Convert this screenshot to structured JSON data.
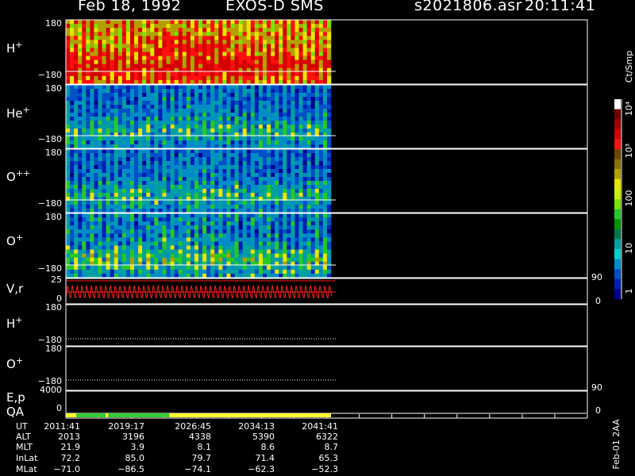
{
  "header": {
    "date": "Feb 18, 1992",
    "instrument": "EXOS-D SMS",
    "file": "s2021806.asr",
    "time": "20:11:41"
  },
  "colorbar": {
    "unit": "Ct/Smp",
    "tick_labels": [
      "10⁴",
      "10³",
      "100",
      "10",
      "1"
    ],
    "colors": [
      "#ffffff",
      "#6e0000",
      "#a00000",
      "#d40000",
      "#ff1010",
      "#6e4600",
      "#8c7000",
      "#b4a000",
      "#e6e600",
      "#c8f000",
      "#78e600",
      "#28c828",
      "#009600",
      "#007846",
      "#00a0a0",
      "#00d2d2",
      "#008cc8",
      "#0050c8",
      "#0020b4",
      "#00008c"
    ]
  },
  "footer": {
    "row_labels": [
      "UT",
      "ALT",
      "MLT",
      "InLat",
      "MLat"
    ],
    "columns": [
      {
        "UT": "2011:41",
        "ALT": "2013",
        "MLT": "21.9",
        "InLat": "72.2",
        "MLat": "−71.0"
      },
      {
        "UT": "2019:17",
        "ALT": "3196",
        "MLT": "3.9",
        "InLat": "85.0",
        "MLat": "−86.5"
      },
      {
        "UT": "2026:45",
        "ALT": "4338",
        "MLT": "8.1",
        "InLat": "79.7",
        "MLat": "−74.1"
      },
      {
        "UT": "2034:13",
        "ALT": "5390",
        "MLT": "8.6",
        "InLat": "71.4",
        "MLat": "−62.3"
      },
      {
        "UT": "2041:41",
        "ALT": "6322",
        "MLT": "8.7",
        "InLat": "65.3",
        "MLat": "−52.3"
      }
    ],
    "stamp": "Feb-01 2AA"
  },
  "chart_data": [
    {
      "type": "heatmap",
      "species": "H⁺",
      "ylabel": "H+",
      "yticks": [
        "180",
        "−180"
      ],
      "ylim": [
        -180,
        180
      ],
      "colorscale": "log counts per sample"
    },
    {
      "type": "heatmap",
      "species": "He⁺",
      "ylabel": "He+",
      "yticks": [
        "180",
        "−180"
      ],
      "ylim": [
        -180,
        180
      ]
    },
    {
      "type": "heatmap",
      "species": "O⁺⁺",
      "ylabel": "O++",
      "yticks": [
        "180",
        "−180"
      ],
      "ylim": [
        -180,
        180
      ]
    },
    {
      "type": "heatmap",
      "species": "O⁺",
      "ylabel": "O+",
      "yticks": [
        "180",
        "−180"
      ],
      "ylim": [
        -180,
        180
      ]
    },
    {
      "type": "line",
      "ylabel": "V,r",
      "left_ticks": [
        "25",
        "0"
      ],
      "right_ticks": [
        "90",
        "0"
      ],
      "ylim": [
        0,
        25
      ]
    },
    {
      "type": "line",
      "ylabel": "H+",
      "yticks": [
        "180",
        "−180"
      ],
      "ylim": [
        -180,
        180
      ]
    },
    {
      "type": "line",
      "ylabel": "O+",
      "yticks": [
        "180",
        "−180"
      ],
      "ylim": [
        -180,
        180
      ]
    },
    {
      "type": "line",
      "ylabel": "E,p",
      "left_ticks": [
        "4000",
        "0"
      ],
      "right_ticks": [
        "90",
        "0"
      ]
    },
    {
      "type": "bar",
      "ylabel": "QA",
      "quality_segments": [
        {
          "color": "#ffff33",
          "from": 0,
          "to": 0.04
        },
        {
          "color": "#33cc33",
          "from": 0.04,
          "to": 0.15
        },
        {
          "color": "#ffff33",
          "from": 0.15,
          "to": 0.16
        },
        {
          "color": "#33cc33",
          "from": 0.16,
          "to": 0.39
        },
        {
          "color": "#ffff33",
          "from": 0.39,
          "to": 1.0
        }
      ]
    }
  ]
}
